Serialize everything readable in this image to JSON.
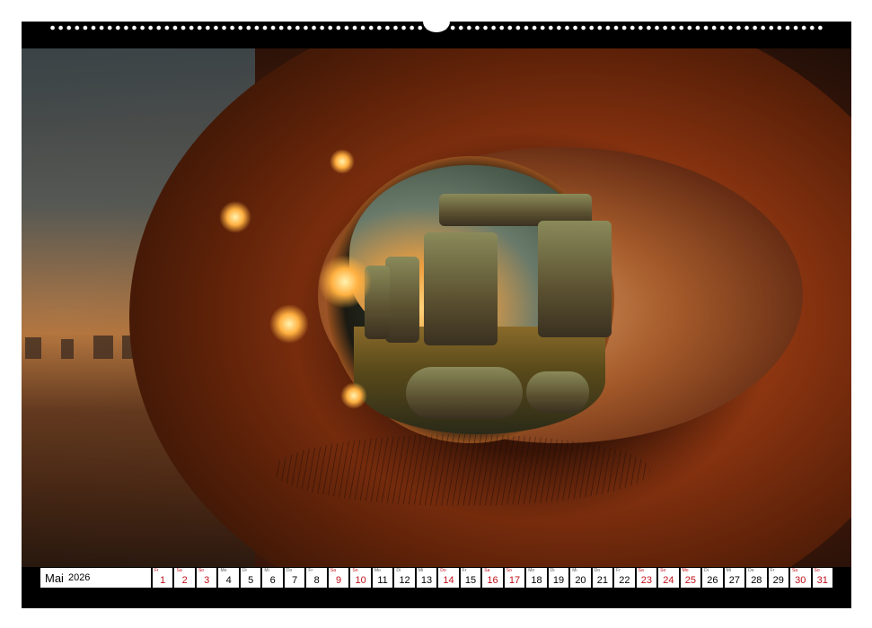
{
  "calendar": {
    "month": "Mai",
    "year": "2026",
    "days": [
      {
        "dow": "Fr",
        "num": "1",
        "red": true
      },
      {
        "dow": "Sa",
        "num": "2",
        "red": true
      },
      {
        "dow": "So",
        "num": "3",
        "red": true
      },
      {
        "dow": "Mo",
        "num": "4",
        "red": false
      },
      {
        "dow": "Di",
        "num": "5",
        "red": false
      },
      {
        "dow": "Mi",
        "num": "6",
        "red": false
      },
      {
        "dow": "Do",
        "num": "7",
        "red": false
      },
      {
        "dow": "Fr",
        "num": "8",
        "red": false
      },
      {
        "dow": "Sa",
        "num": "9",
        "red": true
      },
      {
        "dow": "So",
        "num": "10",
        "red": true
      },
      {
        "dow": "Mo",
        "num": "11",
        "red": false
      },
      {
        "dow": "Di",
        "num": "12",
        "red": false
      },
      {
        "dow": "Mi",
        "num": "13",
        "red": false
      },
      {
        "dow": "Do",
        "num": "14",
        "red": true
      },
      {
        "dow": "Fr",
        "num": "15",
        "red": false
      },
      {
        "dow": "Sa",
        "num": "16",
        "red": true
      },
      {
        "dow": "So",
        "num": "17",
        "red": true
      },
      {
        "dow": "Mo",
        "num": "18",
        "red": false
      },
      {
        "dow": "Di",
        "num": "19",
        "red": false
      },
      {
        "dow": "Mi",
        "num": "20",
        "red": false
      },
      {
        "dow": "Do",
        "num": "21",
        "red": false
      },
      {
        "dow": "Fr",
        "num": "22",
        "red": false
      },
      {
        "dow": "Sa",
        "num": "23",
        "red": true
      },
      {
        "dow": "So",
        "num": "24",
        "red": true
      },
      {
        "dow": "Mo",
        "num": "25",
        "red": true
      },
      {
        "dow": "Di",
        "num": "26",
        "red": false
      },
      {
        "dow": "Mi",
        "num": "27",
        "red": false
      },
      {
        "dow": "Do",
        "num": "28",
        "red": false
      },
      {
        "dow": "Fr",
        "num": "29",
        "red": false
      },
      {
        "dow": "Sa",
        "num": "30",
        "red": true
      },
      {
        "dow": "So",
        "num": "31",
        "red": true
      }
    ]
  },
  "colors": {
    "frame": "#000000",
    "weekday_text": "#000000",
    "holiday_text": "#c0101a"
  }
}
